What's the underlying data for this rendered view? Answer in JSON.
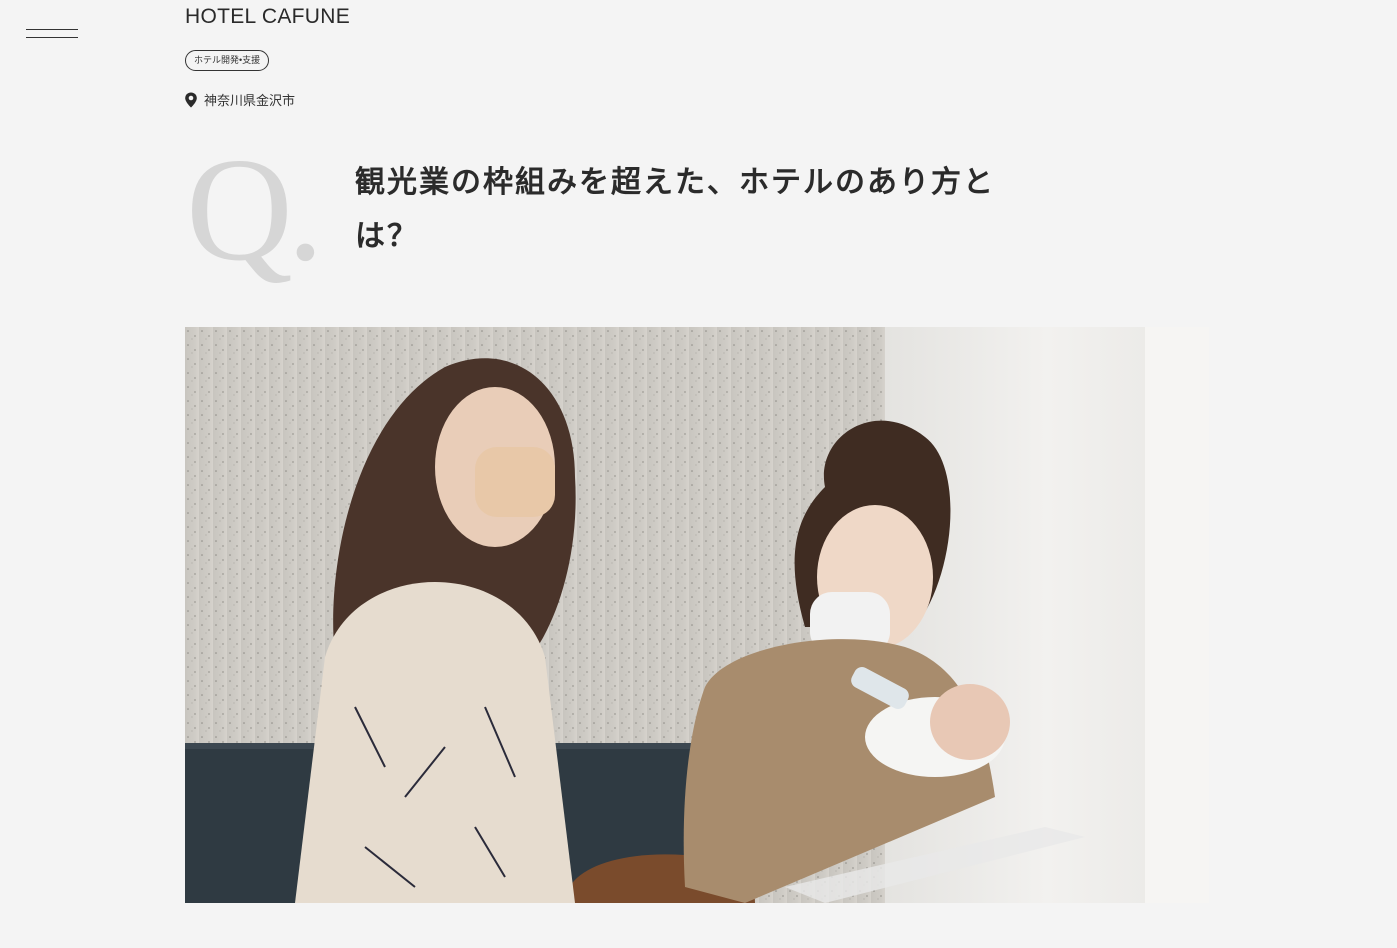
{
  "header": {
    "menu_icon": "hamburger-menu-icon",
    "hotel_name": "HOTEL CAFUNE"
  },
  "tag": {
    "label": "ホテル開発•支援"
  },
  "location": {
    "icon": "map-pin-icon",
    "text": "神奈川県金沢市"
  },
  "qa": {
    "q_mark": "Q.",
    "question_line1": "観光業の枠組みを超えた、ホテルのあり方と",
    "question_line2": "は？"
  },
  "colors": {
    "background": "#f4f4f4",
    "text": "#222222",
    "q_mark": "#d6d6d6"
  }
}
